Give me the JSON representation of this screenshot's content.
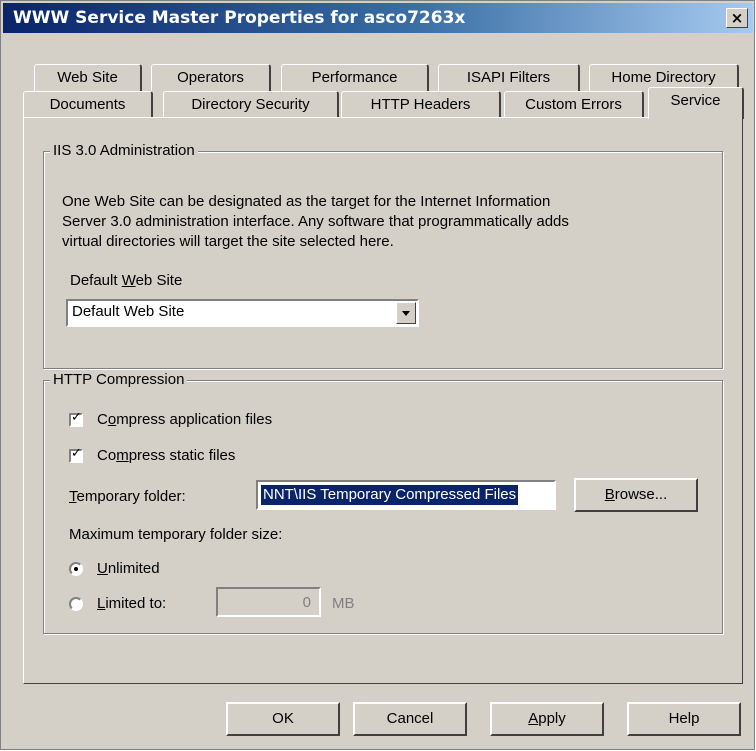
{
  "window": {
    "title": "WWW Service Master Properties for asco7263x",
    "close_glyph": "×"
  },
  "tabs": {
    "row1": [
      "Web Site",
      "Operators",
      "Performance",
      "ISAPI Filters",
      "Home Directory"
    ],
    "row2": [
      "Documents",
      "Directory Security",
      "HTTP Headers",
      "Custom Errors",
      "Service"
    ],
    "active": "Service"
  },
  "iis_admin": {
    "legend": "IIS 3.0 Administration",
    "description_lines": [
      "One Web Site can be designated as the target for the Internet Information",
      "Server 3.0 administration interface.  Any software that programmatically adds",
      "virtual directories will target the site selected here."
    ],
    "default_site_label_pre": "Default ",
    "default_site_label_key": "W",
    "default_site_label_post": "eb Site",
    "default_site_value": "Default Web Site"
  },
  "compression": {
    "legend": "HTTP Compression",
    "app_files": {
      "pre": "C",
      "key": "o",
      "post": "mpress application files",
      "checked": true
    },
    "static_files": {
      "pre": "Co",
      "key": "m",
      "post": "press static files",
      "checked": true
    },
    "temp_folder_label_key": "T",
    "temp_folder_label_post": "emporary folder:",
    "temp_folder_value": "NNT\\IIS Temporary Compressed Files",
    "browse_key": "B",
    "browse_post": "rowse...",
    "max_size_label": "Maximum temporary folder size:",
    "unlimited": {
      "key": "U",
      "post": "nlimited",
      "selected": true
    },
    "limited": {
      "key": "L",
      "post": "imited to:",
      "selected": false
    },
    "limit_value": "0",
    "limit_unit": "MB"
  },
  "buttons": {
    "ok": "OK",
    "cancel": "Cancel",
    "apply_key": "A",
    "apply_post": "pply",
    "help": "Help"
  },
  "colors": {
    "face": "#d4d0c8",
    "title_start": "#0a246a",
    "title_end": "#a6caf0",
    "selection": "#0a246a"
  }
}
